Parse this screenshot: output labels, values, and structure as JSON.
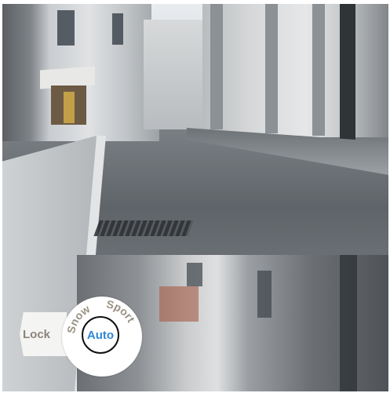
{
  "mode_selector": {
    "lock_label": "Lock",
    "snow_label": "Snow",
    "sport_label": "Sport",
    "auto_label": "Auto",
    "active_mode": "Auto",
    "colors": {
      "auto_text": "#2f86d6",
      "inactive_text": "#9a9284",
      "lock_text": "#8b8479"
    }
  },
  "background": {
    "icon": "wet-street-photo"
  }
}
